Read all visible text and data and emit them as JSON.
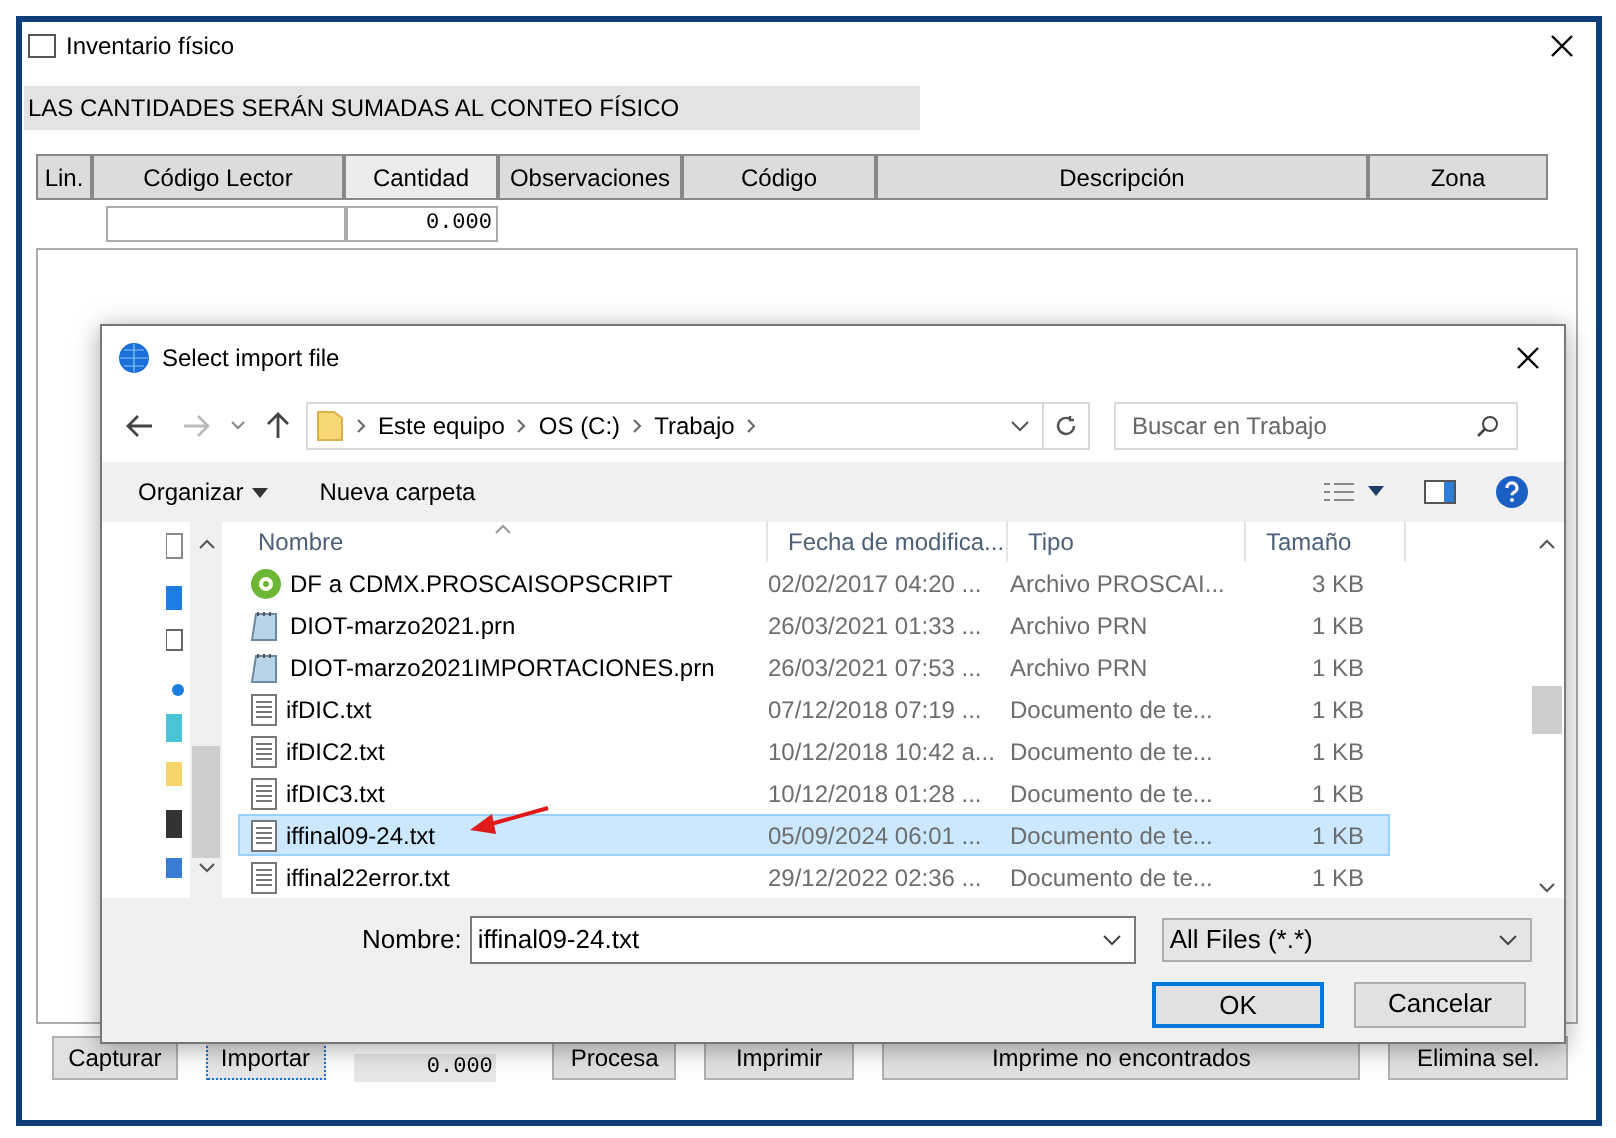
{
  "window": {
    "title": "Inventario físico"
  },
  "banner": "LAS CANTIDADES SERÁN SUMADAS AL CONTEO FÍSICO",
  "grid": {
    "columns": [
      {
        "label": "Lin.",
        "selected": false
      },
      {
        "label": "Código Lector",
        "selected": false
      },
      {
        "label": "Cantidad",
        "selected": true
      },
      {
        "label": "Observaciones",
        "selected": false
      },
      {
        "label": "Código",
        "selected": false
      },
      {
        "label": "Descripción",
        "selected": false
      },
      {
        "label": "Zona",
        "selected": false
      }
    ],
    "entry_quantity": "0.000"
  },
  "buttons": [
    {
      "label": "Capturar",
      "focused": false
    },
    {
      "label": "Importar",
      "focused": true
    },
    {
      "label": "Procesa",
      "focused": false
    },
    {
      "label": "Imprimir",
      "focused": false
    },
    {
      "label": "Imprime no encontrados",
      "focused": false
    },
    {
      "label": "Elimina sel.",
      "focused": false
    }
  ],
  "total": "0.000",
  "dialog": {
    "title": "Select import file",
    "breadcrumb": [
      "Este equipo",
      "OS (C:)",
      "Trabajo"
    ],
    "search": {
      "placeholder": "Buscar en Trabajo"
    },
    "toolbar": [
      "Organizar",
      "Nueva carpeta"
    ],
    "columns": [
      "Nombre",
      "Fecha de modifica...",
      "Tipo",
      "Tamaño"
    ],
    "rows": [
      {
        "kind": "script",
        "name": "DF a CDMX.PROSCAISOPSCRIPT",
        "date": "02/02/2017 04:20 ...",
        "type": "Archivo PROSCAI...",
        "size": "3 KB",
        "selected": false
      },
      {
        "kind": "prn",
        "name": "DIOT-marzo2021.prn",
        "date": "26/03/2021 01:33 ...",
        "type": "Archivo PRN",
        "size": "1 KB",
        "selected": false
      },
      {
        "kind": "prn",
        "name": "DIOT-marzo2021IMPORTACIONES.prn",
        "date": "26/03/2021 07:53 ...",
        "type": "Archivo PRN",
        "size": "1 KB",
        "selected": false
      },
      {
        "kind": "txt",
        "name": "ifDIC.txt",
        "date": "07/12/2018 07:19 ...",
        "type": "Documento de te...",
        "size": "1 KB",
        "selected": false
      },
      {
        "kind": "txt",
        "name": "ifDIC2.txt",
        "date": "10/12/2018 10:42 a...",
        "type": "Documento de te...",
        "size": "1 KB",
        "selected": false
      },
      {
        "kind": "txt",
        "name": "ifDIC3.txt",
        "date": "10/12/2018 01:28 ...",
        "type": "Documento de te...",
        "size": "1 KB",
        "selected": false
      },
      {
        "kind": "txt",
        "name": "iffinal09-24.txt",
        "date": "05/09/2024 06:01 ...",
        "type": "Documento de te...",
        "size": "1 KB",
        "selected": true
      },
      {
        "kind": "txt",
        "name": "iffinal22error.txt",
        "date": "29/12/2022 02:36 ...",
        "type": "Documento de te...",
        "size": "1 KB",
        "selected": false
      }
    ],
    "filename_label": "Nombre:",
    "filename": "iffinal09-24.txt",
    "filter": "All Files (*.*)",
    "buttons": [
      "OK",
      "Cancelar"
    ]
  }
}
